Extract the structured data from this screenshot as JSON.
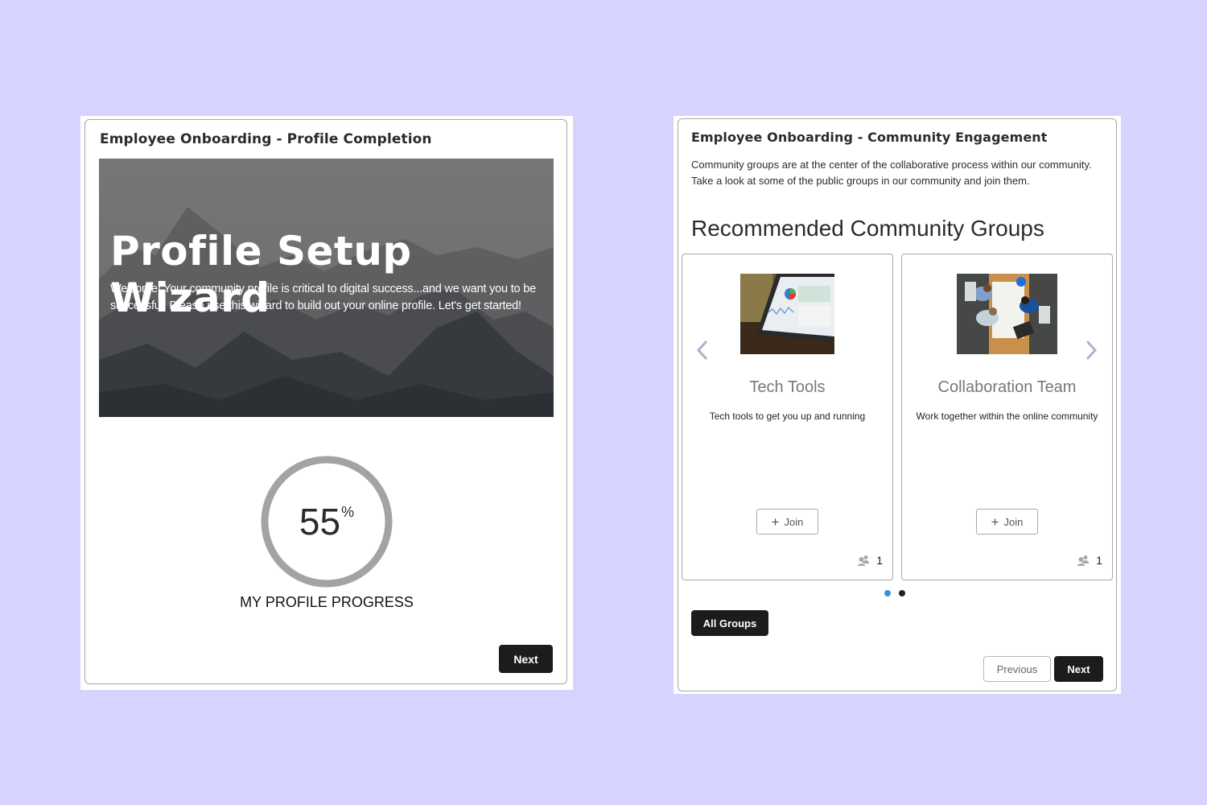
{
  "profile_card": {
    "title": "Employee Onboarding - Profile Completion",
    "hero": {
      "title": "Profile Setup Wizard",
      "text": "Welcome! Your community profile is critical to digital success...and we want you to be successful. Please use this wizard to build out your online profile. Let's get started!",
      "image": "mountain-landscape"
    },
    "progress": {
      "value": "55",
      "percent_sign": "%",
      "fraction": 0.55,
      "label": "MY PROFILE PROGRESS",
      "ring_color": "#a3a3a3"
    },
    "next_label": "Next"
  },
  "community_card": {
    "title": "Employee Onboarding - Community Engagement",
    "intro": "Community groups are at the center of the collaborative process within our community. Take a look at some of the public groups in our community and join them.",
    "section_title": "Recommended Community Groups",
    "groups": [
      {
        "name": "Tech Tools",
        "description": "Tech tools to get you up and running",
        "image": "tablet-analytics-photo",
        "join_label": "Join",
        "member_count": "1"
      },
      {
        "name": "Collaboration Team",
        "description": "Work together within the online community",
        "image": "team-meeting-photo",
        "join_label": "Join",
        "member_count": "1"
      }
    ],
    "carousel": {
      "pages": 2,
      "active_page": 1,
      "active_color": "#3b8fd6"
    },
    "all_groups_label": "All Groups",
    "previous_label": "Previous",
    "next_label": "Next"
  },
  "colors": {
    "page_background": "#d6d4fe",
    "button_dark": "#1c1c1c",
    "arrow": "#a9b6cc"
  }
}
